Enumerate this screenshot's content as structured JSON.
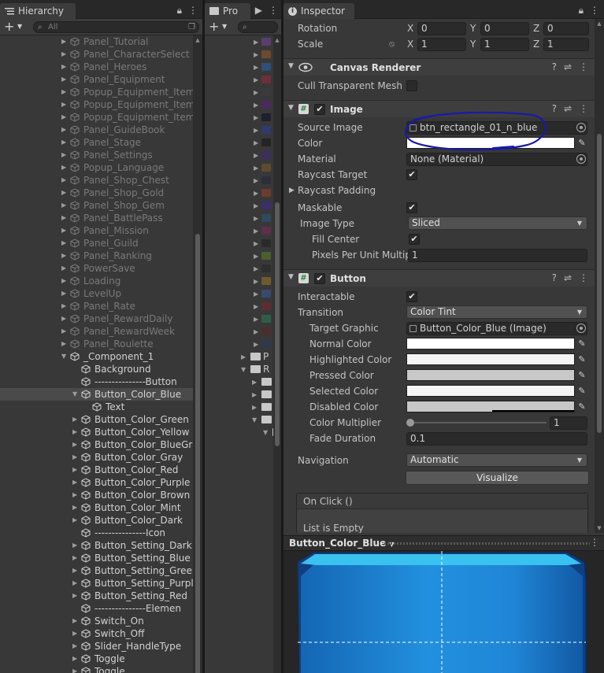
{
  "hierarchy": {
    "tab_label": "Hierarchy",
    "search_placeholder": "All",
    "rows": [
      {
        "label": "Panel_Tutorial",
        "depth": 1,
        "fold": "closed",
        "state": "inactive"
      },
      {
        "label": "Panel_CharacterSelect",
        "depth": 1,
        "fold": "closed",
        "state": "inactive"
      },
      {
        "label": "Panel_Heroes",
        "depth": 1,
        "fold": "closed",
        "state": "inactive"
      },
      {
        "label": "Panel_Equipment",
        "depth": 1,
        "fold": "closed",
        "state": "inactive"
      },
      {
        "label": "Popup_Equipment_ItemD",
        "depth": 1,
        "fold": "closed",
        "state": "inactive"
      },
      {
        "label": "Popup_Equipment_ItemD",
        "depth": 1,
        "fold": "closed",
        "state": "inactive"
      },
      {
        "label": "Popup_Equipment_ItemD",
        "depth": 1,
        "fold": "closed",
        "state": "inactive"
      },
      {
        "label": "Panel_GuideBook",
        "depth": 1,
        "fold": "closed",
        "state": "inactive"
      },
      {
        "label": "Panel_Stage",
        "depth": 1,
        "fold": "closed",
        "state": "inactive"
      },
      {
        "label": "Panel_Settings",
        "depth": 1,
        "fold": "closed",
        "state": "inactive"
      },
      {
        "label": "Popup_Language",
        "depth": 1,
        "fold": "closed",
        "state": "inactive"
      },
      {
        "label": "Panel_Shop_Chest",
        "depth": 1,
        "fold": "closed",
        "state": "inactive"
      },
      {
        "label": "Panel_Shop_Gold",
        "depth": 1,
        "fold": "closed",
        "state": "inactive"
      },
      {
        "label": "Panel_Shop_Gem",
        "depth": 1,
        "fold": "closed",
        "state": "inactive"
      },
      {
        "label": "Panel_BattlePass",
        "depth": 1,
        "fold": "closed",
        "state": "inactive"
      },
      {
        "label": "Panel_Mission",
        "depth": 1,
        "fold": "closed",
        "state": "inactive"
      },
      {
        "label": "Panel_Guild",
        "depth": 1,
        "fold": "closed",
        "state": "inactive"
      },
      {
        "label": "Panel_Ranking",
        "depth": 1,
        "fold": "closed",
        "state": "inactive"
      },
      {
        "label": "PowerSave",
        "depth": 1,
        "fold": "closed",
        "state": "inactive"
      },
      {
        "label": "Loading",
        "depth": 1,
        "fold": "closed",
        "state": "inactive"
      },
      {
        "label": "LevelUp",
        "depth": 1,
        "fold": "closed",
        "state": "inactive"
      },
      {
        "label": "Panel_Rate",
        "depth": 1,
        "fold": "closed",
        "state": "inactive"
      },
      {
        "label": "Panel_RewardDaily",
        "depth": 1,
        "fold": "closed",
        "state": "inactive"
      },
      {
        "label": "Panel_RewardWeek",
        "depth": 1,
        "fold": "closed",
        "state": "inactive"
      },
      {
        "label": "Panel_Roulette",
        "depth": 1,
        "fold": "closed",
        "state": "inactive"
      },
      {
        "label": "_Component_1",
        "depth": 1,
        "fold": "open",
        "state": "active"
      },
      {
        "label": "Background",
        "depth": 2,
        "fold": "none",
        "state": "active"
      },
      {
        "label": "---------------Button",
        "depth": 2,
        "fold": "none",
        "state": "active"
      },
      {
        "label": "Button_Color_Blue",
        "depth": 2,
        "fold": "open",
        "state": "selected"
      },
      {
        "label": "Text",
        "depth": 3,
        "fold": "none",
        "state": "active"
      },
      {
        "label": "Button_Color_Green",
        "depth": 2,
        "fold": "closed",
        "state": "active"
      },
      {
        "label": "Button_Color_Yellow",
        "depth": 2,
        "fold": "closed",
        "state": "active"
      },
      {
        "label": "Button_Color_BlueGra",
        "depth": 2,
        "fold": "closed",
        "state": "active"
      },
      {
        "label": "Button_Color_Gray",
        "depth": 2,
        "fold": "closed",
        "state": "active"
      },
      {
        "label": "Button_Color_Red",
        "depth": 2,
        "fold": "closed",
        "state": "active"
      },
      {
        "label": "Button_Color_Purple",
        "depth": 2,
        "fold": "closed",
        "state": "active"
      },
      {
        "label": "Button_Color_Brown",
        "depth": 2,
        "fold": "closed",
        "state": "active"
      },
      {
        "label": "Button_Color_Mint",
        "depth": 2,
        "fold": "closed",
        "state": "active"
      },
      {
        "label": "Button_Color_Dark",
        "depth": 2,
        "fold": "closed",
        "state": "active"
      },
      {
        "label": "---------------Icon",
        "depth": 2,
        "fold": "none",
        "state": "active"
      },
      {
        "label": "Button_Setting_Dark",
        "depth": 2,
        "fold": "closed",
        "state": "active"
      },
      {
        "label": "Button_Setting_Blue",
        "depth": 2,
        "fold": "closed",
        "state": "active"
      },
      {
        "label": "Button_Setting_Green",
        "depth": 2,
        "fold": "closed",
        "state": "active"
      },
      {
        "label": "Button_Setting_Purple",
        "depth": 2,
        "fold": "closed",
        "state": "active"
      },
      {
        "label": "Button_Setting_Red",
        "depth": 2,
        "fold": "closed",
        "state": "active"
      },
      {
        "label": "---------------Elemen",
        "depth": 2,
        "fold": "none",
        "state": "active"
      },
      {
        "label": "Switch_On",
        "depth": 2,
        "fold": "closed",
        "state": "active"
      },
      {
        "label": "Switch_Off",
        "depth": 2,
        "fold": "closed",
        "state": "active"
      },
      {
        "label": "Slider_HandleType",
        "depth": 2,
        "fold": "closed",
        "state": "active"
      },
      {
        "label": "Toggle",
        "depth": 2,
        "fold": "closed",
        "state": "active"
      },
      {
        "label": "Toggle",
        "depth": 2,
        "fold": "closed",
        "state": "active"
      }
    ]
  },
  "project": {
    "tab_label": "Pro",
    "rows": [
      {
        "type": "thumb",
        "color": "#5a3f6e"
      },
      {
        "type": "thumb",
        "color": "#6d4a2e"
      },
      {
        "type": "thumb",
        "color": "#2f4e78"
      },
      {
        "type": "thumb",
        "color": "#6e2f3a"
      },
      {
        "type": "thumb",
        "color": "#3a3a3a"
      },
      {
        "type": "thumb",
        "color": "#4a2a5e"
      },
      {
        "type": "thumb",
        "color": "#1f1f2e"
      },
      {
        "type": "thumb",
        "color": "#2f3a6e"
      },
      {
        "type": "thumb",
        "color": "#242424"
      },
      {
        "type": "thumb",
        "color": "#3d2e5e"
      },
      {
        "type": "thumb",
        "color": "#5e4a2e"
      },
      {
        "type": "thumb",
        "color": "#2e2e3a"
      },
      {
        "type": "thumb",
        "color": "#6e3a2e"
      },
      {
        "type": "thumb",
        "color": "#3a2e6e"
      },
      {
        "type": "thumb",
        "color": "#2e4a5e"
      },
      {
        "type": "thumb",
        "color": "#5e2e4a"
      },
      {
        "type": "thumb",
        "color": "#2a2a2a"
      },
      {
        "type": "thumb",
        "color": "#4a5e2e"
      },
      {
        "type": "thumb",
        "color": "#2e2e2e"
      },
      {
        "type": "thumb",
        "color": "#6e5a2e"
      },
      {
        "type": "thumb",
        "color": "#3a4a6e"
      },
      {
        "type": "thumb",
        "color": "#5e2e2e"
      },
      {
        "type": "thumb",
        "color": "#2e5e4a"
      },
      {
        "type": "thumb",
        "color": "#4a2e2e"
      },
      {
        "type": "thumb",
        "color": "#2e3a4a"
      },
      {
        "type": "folder",
        "label": "P",
        "fold": "closed",
        "indent": 0
      },
      {
        "type": "folder",
        "label": "R",
        "fold": "open",
        "indent": 0
      },
      {
        "type": "folder",
        "label": "",
        "fold": "closed",
        "indent": 1
      },
      {
        "type": "folder",
        "label": "",
        "fold": "closed",
        "indent": 1
      },
      {
        "type": "folder",
        "label": "",
        "fold": "closed",
        "indent": 1
      },
      {
        "type": "folder",
        "label": "",
        "fold": "open",
        "indent": 1
      },
      {
        "type": "folder",
        "label": "",
        "fold": "open",
        "indent": 2
      }
    ]
  },
  "inspector": {
    "tab_label": "Inspector",
    "transform": {
      "rotation_label": "Rotation",
      "rotation": {
        "x": "0",
        "y": "0",
        "z": "0"
      },
      "scale_label": "Scale",
      "scale": {
        "x": "1",
        "y": "1",
        "z": "1"
      },
      "axis_x": "X",
      "axis_y": "Y",
      "axis_z": "Z"
    },
    "canvas_renderer": {
      "title": "Canvas Renderer",
      "cull_label": "Cull Transparent Mesh",
      "cull_checked": false
    },
    "image": {
      "title": "Image",
      "source_image_label": "Source Image",
      "source_image_value": "btn_rectangle_01_n_blue",
      "color_label": "Color",
      "material_label": "Material",
      "material_value": "None (Material)",
      "raycast_target_label": "Raycast Target",
      "raycast_padding_label": "Raycast Padding",
      "maskable_label": "Maskable",
      "image_type_label": "Image Type",
      "image_type_value": "Sliced",
      "fill_center_label": "Fill Center",
      "ppu_label": "Pixels Per Unit Multipl",
      "ppu_value": "1"
    },
    "button": {
      "title": "Button",
      "interactable_label": "Interactable",
      "transition_label": "Transition",
      "transition_value": "Color Tint",
      "target_graphic_label": "Target Graphic",
      "target_graphic_value": "Button_Color_Blue (Image)",
      "normal_color_label": "Normal Color",
      "highlighted_color_label": "Highlighted Color",
      "pressed_color_label": "Pressed Color",
      "selected_color_label": "Selected Color",
      "disabled_color_label": "Disabled Color",
      "color_multiplier_label": "Color Multiplier",
      "color_multiplier_value": "1",
      "fade_duration_label": "Fade Duration",
      "fade_duration_value": "0.1",
      "navigation_label": "Navigation",
      "navigation_value": "Automatic",
      "visualize_label": "Visualize",
      "onclick_label": "On Click ()",
      "list_empty_label": "List is Empty"
    },
    "preview": {
      "title": "Button_Color_Blue"
    }
  },
  "colors": {
    "annotation_ink": "#1a1aa8",
    "button_blue": "#1f86d6",
    "button_edge": "#39c1f0",
    "normal_color": "#ffffff",
    "highlighted_color": "#f5f5f5",
    "pressed_color": "#c8c8c8",
    "selected_color": "#f5f5f5",
    "disabled_color": "#c8c8c8"
  }
}
